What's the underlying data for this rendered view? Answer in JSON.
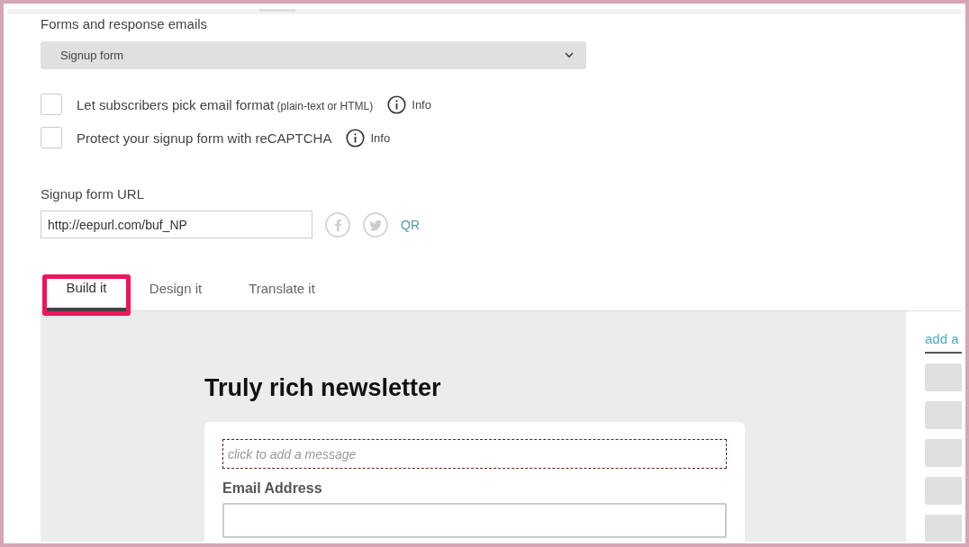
{
  "section_title": "Forms and response emails",
  "form_select": {
    "value": "Signup form"
  },
  "options": [
    {
      "label": "Let subscribers pick email format",
      "hint": "(plain-text or HTML)",
      "info": "Info",
      "checked": false
    },
    {
      "label": "Protect your signup form with reCAPTCHA",
      "info": "Info",
      "checked": false
    }
  ],
  "url": {
    "label": "Signup form URL",
    "value": "http://eepurl.com/buf_NP",
    "qr": "QR"
  },
  "tabs": [
    {
      "label": "Build it",
      "selected": true,
      "highlighted": true
    },
    {
      "label": "Design it",
      "selected": false,
      "highlighted": false
    },
    {
      "label": "Translate it",
      "selected": false,
      "highlighted": false
    }
  ],
  "preview": {
    "title": "Truly rich newsletter",
    "message_placeholder": "click to add a message",
    "field_label": "Email Address"
  },
  "side_panel": {
    "heading": "add a"
  }
}
